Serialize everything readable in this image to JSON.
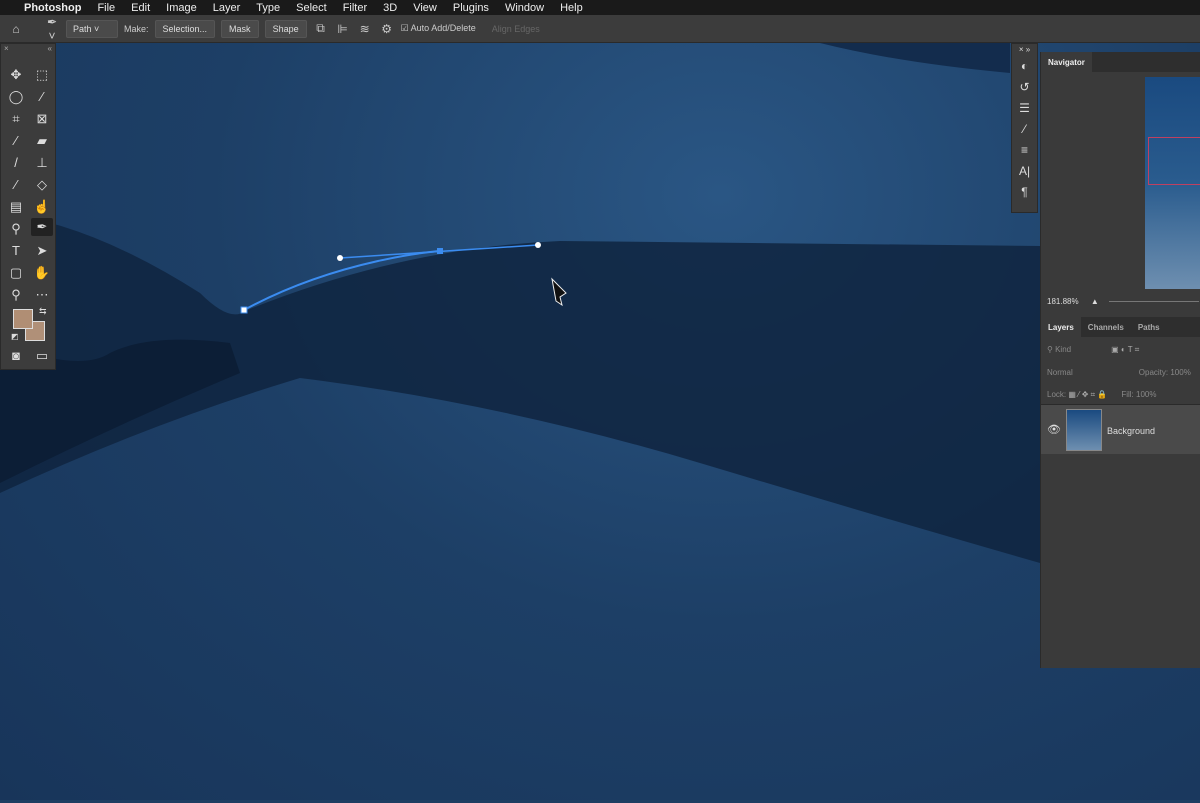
{
  "menubar": {
    "apple": "",
    "items": [
      "Photoshop",
      "File",
      "Edit",
      "Image",
      "Layer",
      "Type",
      "Select",
      "Filter",
      "3D",
      "View",
      "Plugins",
      "Window",
      "Help"
    ]
  },
  "options": {
    "mode": "Path",
    "make_label": "Make:",
    "selection": "Selection...",
    "mask": "Mask",
    "shape": "Shape",
    "auto_add_delete": "Auto Add/Delete",
    "auto_add_checked": true,
    "align_edges": "Align Edges"
  },
  "tools": [
    "move",
    "marquee",
    "lasso",
    "magic-wand",
    "crop",
    "frame",
    "eyedropper",
    "healing",
    "brush",
    "stamp",
    "history-brush",
    "eraser",
    "gradient",
    "smudge",
    "dodge",
    "pen",
    "type",
    "path-selection",
    "rectangle",
    "hand",
    "zoom",
    "more"
  ],
  "colors": {
    "foreground": "#b08e74",
    "background": "#b09078",
    "path": "#3b8cf0"
  },
  "navigator": {
    "tab": "Navigator",
    "zoom": "181.88%"
  },
  "layers": {
    "tabs": [
      "Layers",
      "Channels",
      "Paths"
    ],
    "kind": "Kind",
    "blend": "Normal",
    "opacity_label": "Opacity:",
    "opacity": "100%",
    "lock_label": "Lock:",
    "fill_label": "Fill:",
    "fill": "100%",
    "items": [
      {
        "name": "Background",
        "visible": true
      }
    ]
  }
}
